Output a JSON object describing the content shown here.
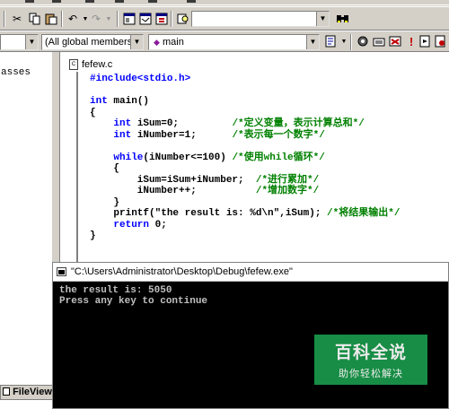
{
  "toolbar1": {
    "search_combo": "",
    "icons": [
      "cut-icon",
      "copy-icon",
      "paste-icon",
      "undo-icon",
      "redo-icon",
      "workspace-icon",
      "output-icon",
      "window-list-icon",
      "find-in-files-icon",
      "find-icon"
    ]
  },
  "toolbar2": {
    "class_combo": "",
    "members_combo": "(All global members",
    "function_combo": "main",
    "function_icon_color": "#8b1a9b"
  },
  "left_panel": {
    "class_text": "asses",
    "fileview_tab": "FileView"
  },
  "editor": {
    "tab_label": "fefew.c",
    "lines": [
      {
        "t": "#include<stdio.h>",
        "c": "kw"
      },
      {
        "t": "",
        "c": ""
      },
      {
        "t": "int main()",
        "c": "mixed_intmain"
      },
      {
        "t": "{",
        "c": ""
      },
      {
        "t": "    int iSum=0;         /*定义变量，表示计算总和*/",
        "c": "decl1"
      },
      {
        "t": "    int iNumber=1;      /*表示每一个数字*/",
        "c": "decl2"
      },
      {
        "t": "",
        "c": ""
      },
      {
        "t": "    while(iNumber<=100) /*使用while循环*/",
        "c": "while"
      },
      {
        "t": "    {",
        "c": ""
      },
      {
        "t": "        iSum=iSum+iNumber;  /*进行累加*/",
        "c": "acc"
      },
      {
        "t": "        iNumber++;          /*增加数字*/",
        "c": "inc"
      },
      {
        "t": "    }",
        "c": ""
      },
      {
        "t": "    printf(\"the result is: %d\\n\",iSum); /*将结果输出*/",
        "c": "printf"
      },
      {
        "t": "    return 0;",
        "c": "ret"
      },
      {
        "t": "}",
        "c": ""
      }
    ]
  },
  "console": {
    "title": "\"C:\\Users\\Administrator\\Desktop\\Debug\\fefew.exe\"",
    "output_line1": "the result is: 5050",
    "output_line2": "Press any key to continue"
  },
  "watermark": {
    "title": "百科全说",
    "subtitle": "助你轻松解决",
    "color": "#1a9a4b"
  }
}
